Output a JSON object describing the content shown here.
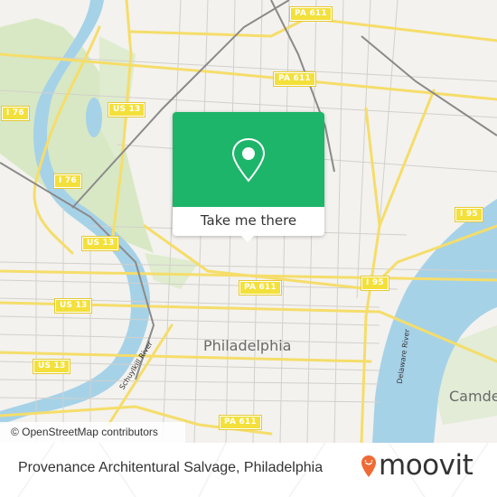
{
  "map": {
    "city_labels": [
      {
        "id": "philadelphia",
        "text": "Philadelphia"
      },
      {
        "id": "camden",
        "text": "Camden"
      }
    ],
    "river_labels": [
      {
        "id": "schuylkill",
        "text": "Schuylkill River"
      },
      {
        "id": "delaware",
        "text": "Delaware River"
      }
    ],
    "route_shields": [
      {
        "id": "pa611-top",
        "text": "PA 611"
      },
      {
        "id": "pa611-upper",
        "text": "PA 611"
      },
      {
        "id": "us13-north",
        "text": "US 13"
      },
      {
        "id": "i76-north",
        "text": "I 76"
      },
      {
        "id": "i76-south",
        "text": "I 76"
      },
      {
        "id": "us13-mid",
        "text": "US 13"
      },
      {
        "id": "pa611-center",
        "text": "PA 611"
      },
      {
        "id": "i95-north",
        "text": "I 95"
      },
      {
        "id": "i95-east",
        "text": "I 95"
      },
      {
        "id": "us13-west",
        "text": "US 13"
      },
      {
        "id": "us13-southwest",
        "text": "US 13"
      },
      {
        "id": "pa611-south",
        "text": "PA 611"
      }
    ],
    "attribution": "© OpenStreetMap contributors"
  },
  "popup": {
    "icon": "map-pin-icon",
    "button_label": "Take me there",
    "accent_color": "#1db56a"
  },
  "footer": {
    "place_title": "Provenance Architentural Salvage, Philadelphia",
    "brand_name": "moovit",
    "brand_color": "#f06a35"
  }
}
